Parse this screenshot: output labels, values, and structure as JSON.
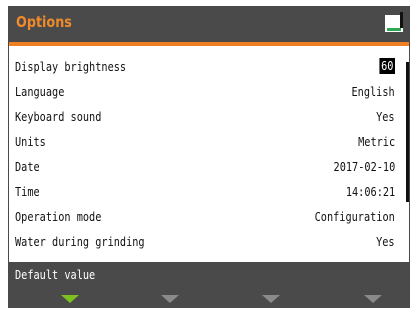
{
  "header": {
    "title": "Options"
  },
  "settings": [
    {
      "label": "Display brightness",
      "value": "60",
      "selected": true
    },
    {
      "label": "Language",
      "value": "English"
    },
    {
      "label": "Keyboard sound",
      "value": "Yes"
    },
    {
      "label": "Units",
      "value": "Metric"
    },
    {
      "label": "Date",
      "value": "2017-02-10"
    },
    {
      "label": "Time",
      "value": "14:06:21"
    },
    {
      "label": "Operation mode",
      "value": "Configuration"
    },
    {
      "label": "Water during grinding",
      "value": "Yes"
    }
  ],
  "footer": {
    "hint": "Default value"
  },
  "colors": {
    "accent": "#ee7f22",
    "bar": "#4a4a4a",
    "softkey_active": "#7cc21e",
    "softkey_inactive": "#8a8a8a"
  },
  "icons": {
    "corner": "battery-icon"
  }
}
